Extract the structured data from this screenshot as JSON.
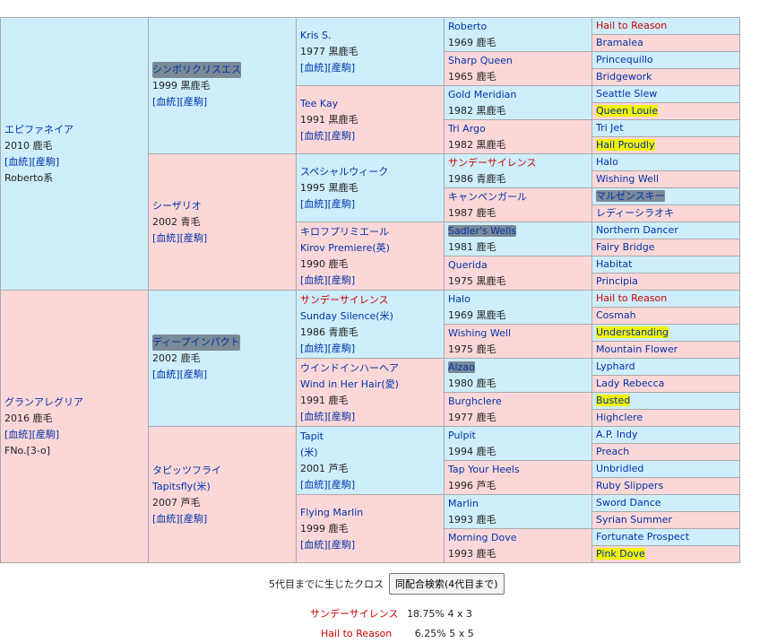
{
  "gen1": [
    {
      "name": "エピファネイア",
      "year": "2010 鹿毛",
      "links": "[血統][産駒]",
      "line": "Roberto系"
    },
    {
      "name": "グランアレグリア",
      "year": "2016 鹿毛",
      "links": "[血統][産駒]",
      "line": "FNo.[3-o]"
    }
  ],
  "gen2": [
    {
      "name": "シンボリクリスエス",
      "year": "1999 黒鹿毛",
      "links": "[血統][産駒]"
    },
    {
      "name": "シーザリオ",
      "year": "2002 青毛",
      "links": "[血統][産駒]"
    },
    {
      "name": "ディープインパクト",
      "year": "2002 鹿毛",
      "links": "[血統][産駒]"
    },
    {
      "name": "タピッツフライ",
      "sub": "Tapitsfly(米)",
      "year": "2007 芦毛",
      "links": "[血統][産駒]"
    }
  ],
  "gen3": [
    {
      "name": "Kris S.",
      "year": "1977 黒鹿毛",
      "links": "[血統][産駒]"
    },
    {
      "name": "Tee Kay",
      "year": "1991 黒鹿毛",
      "links": "[血統][産駒]"
    },
    {
      "name": "スペシャルウィーク",
      "year": "1995 黒鹿毛",
      "links": "[血統][産駒]"
    },
    {
      "name": "キロフプリミエール",
      "sub": "Kirov Premiere(英)",
      "year": "1990 鹿毛",
      "links": "[血統][産駒]"
    },
    {
      "name": "サンデーサイレンス",
      "sub": "Sunday Silence(米)",
      "year": "1986 青鹿毛",
      "links": "[血統][産駒]"
    },
    {
      "name": "ウインドインハーヘア",
      "sub": "Wind in Her Hair(愛)",
      "year": "1991 鹿毛",
      "links": "[血統][産駒]"
    },
    {
      "name": "Tapit",
      "sub": "(米)",
      "year": "2001 芦毛",
      "links": "[血統][産駒]"
    },
    {
      "name": "Flying Marlin",
      "year": "1999 鹿毛",
      "links": "[血統][産駒]"
    }
  ],
  "gen4": [
    {
      "name": "Roberto",
      "year": "1969 鹿毛"
    },
    {
      "name": "Sharp Queen",
      "year": "1965 鹿毛"
    },
    {
      "name": "Gold Meridian",
      "year": "1982 黒鹿毛"
    },
    {
      "name": "Tri Argo",
      "year": "1982 黒鹿毛"
    },
    {
      "name": "サンデーサイレンス",
      "year": "1986 青鹿毛"
    },
    {
      "name": "キャンペンガール",
      "year": "1987 鹿毛"
    },
    {
      "name": "Sadler's Wells",
      "year": "1981 鹿毛"
    },
    {
      "name": "Querida",
      "year": "1975 黒鹿毛"
    },
    {
      "name": "Halo",
      "year": "1969 黒鹿毛"
    },
    {
      "name": "Wishing Well",
      "year": "1975 鹿毛"
    },
    {
      "name": "Alzao",
      "year": "1980 鹿毛"
    },
    {
      "name": "Burghclere",
      "year": "1977 鹿毛"
    },
    {
      "name": "Pulpit",
      "year": "1994 鹿毛"
    },
    {
      "name": "Tap Your Heels",
      "year": "1996 芦毛"
    },
    {
      "name": "Marlin",
      "year": "1993 鹿毛"
    },
    {
      "name": "Morning Dove",
      "year": "1993 鹿毛"
    }
  ],
  "gen5": [
    "Hail to Reason",
    "Bramalea",
    "Princequillo",
    "Bridgework",
    "Seattle Slew",
    "Queen Louie",
    "Tri Jet",
    "Hail Proudly",
    "Halo",
    "Wishing Well",
    "マルゼンスキー",
    "レディーシラオキ",
    "Northern Dancer",
    "Fairy Bridge",
    "Habitat",
    "Principia",
    "Hail to Reason",
    "Cosmah",
    "Understanding",
    "Mountain Flower",
    "Lyphard",
    "Lady Rebecca",
    "Busted",
    "Highclere",
    "A.P. Indy",
    "Preach",
    "Unbridled",
    "Ruby Slippers",
    "Sword Dance",
    "Syrian Summer",
    "Fortunate Prospect",
    "Pink Dove"
  ],
  "footer": {
    "cross_label": "5代目までに生じたクロス",
    "search_button": "同配合検索(4代目まで)",
    "crosses": [
      {
        "name": "サンデーサイレンス",
        "value": "18.75%  4 x 3"
      },
      {
        "name": "Hail to Reason",
        "value": "6.25%  5 x 5"
      }
    ]
  },
  "colors": {
    "sire_bg": "#cdeefa",
    "dam_bg": "#fbd7d7",
    "link": "#0033aa",
    "highlight": "#f2f200",
    "red_name": "#cc0000"
  }
}
